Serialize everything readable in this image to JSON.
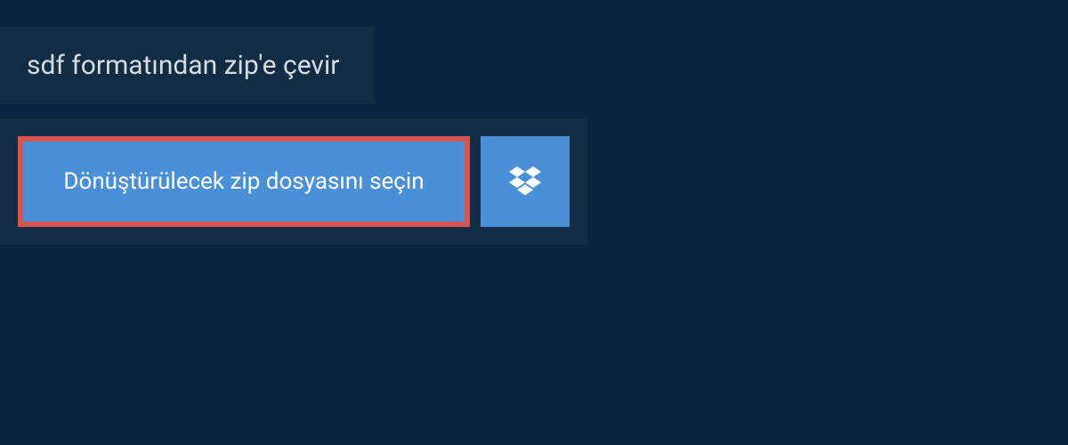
{
  "header": {
    "title": "sdf formatından zip'e çevir"
  },
  "upload": {
    "select_file_label": "Dönüştürülecek zip dosyasını seçin",
    "dropbox_icon_name": "dropbox-icon"
  },
  "colors": {
    "page_bg": "#0a2540",
    "panel_bg": "#122c44",
    "button_bg": "#4a90d9",
    "highlight_border": "#d9544f",
    "text_light": "#d5dde4",
    "text_white": "#ffffff"
  }
}
